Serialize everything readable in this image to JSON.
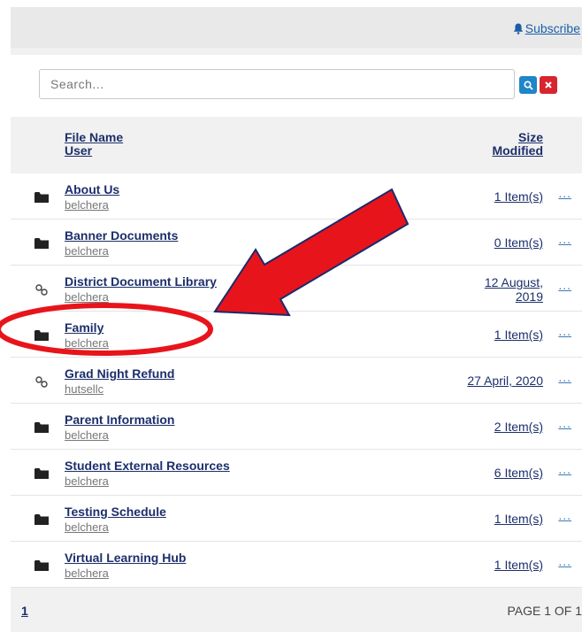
{
  "subscribe": {
    "label": "Subscribe"
  },
  "search": {
    "placeholder": "Search...",
    "value": ""
  },
  "columns": {
    "file_name": "File Name",
    "user": "User",
    "size": "Size",
    "modified": "Modified"
  },
  "rows": [
    {
      "name": "About Us",
      "user": "belchera",
      "size": "1 Item(s)",
      "icon": "folder-icon"
    },
    {
      "name": "Banner Documents",
      "user": "belchera",
      "size": "0 Item(s)",
      "icon": "folder-icon"
    },
    {
      "name": "District Document Library",
      "user": "belchera",
      "size": "12 August, 2019",
      "icon": "link-icon"
    },
    {
      "name": "Family",
      "user": "belchera",
      "size": "1 Item(s)",
      "icon": "folder-icon"
    },
    {
      "name": "Grad Night Refund",
      "user": "hutsellc",
      "size": "27 April, 2020",
      "icon": "link-icon"
    },
    {
      "name": "Parent Information",
      "user": "belchera",
      "size": "2 Item(s)",
      "icon": "folder-icon"
    },
    {
      "name": "Student External Resources",
      "user": "belchera",
      "size": "6 Item(s)",
      "icon": "folder-icon"
    },
    {
      "name": "Testing Schedule",
      "user": "belchera",
      "size": "1 Item(s)",
      "icon": "folder-icon"
    },
    {
      "name": "Virtual Learning Hub",
      "user": "belchera",
      "size": "1 Item(s)",
      "icon": "folder-icon"
    }
  ],
  "more_label": "...",
  "pagination": {
    "current_page": "1",
    "info": "PAGE 1 OF 1"
  },
  "colors": {
    "link": "#1c2f6b",
    "search_button": "#1f86c8",
    "clear_button": "#d7262e",
    "annotation": "#e8141b"
  }
}
